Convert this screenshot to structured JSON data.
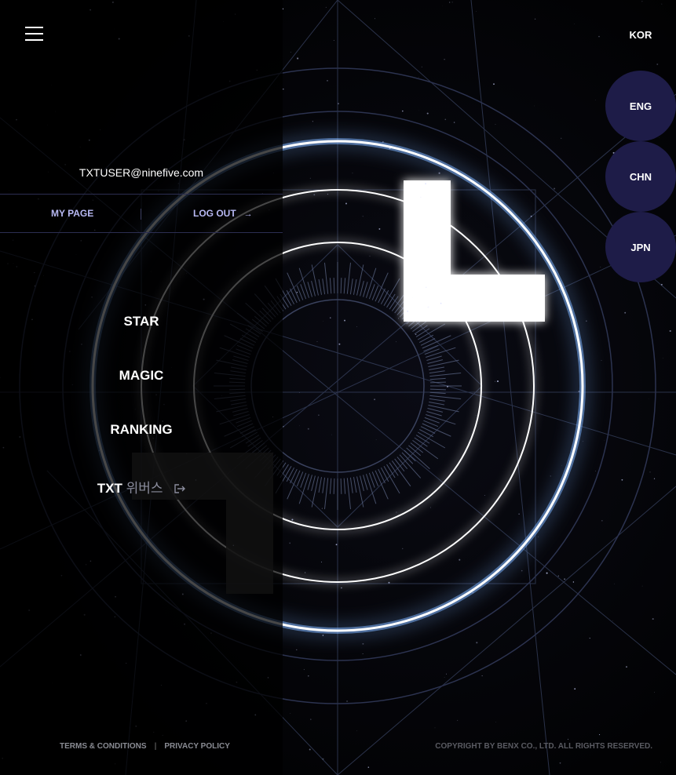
{
  "header": {
    "menu_icon": "hamburger-icon",
    "current_language": "KOR"
  },
  "languages": [
    "ENG",
    "CHN",
    "JPN"
  ],
  "user": {
    "email": "TXTUSER@ninefive.com"
  },
  "account": {
    "mypage_label": "MY PAGE",
    "logout_label": "LOG OUT",
    "logout_icon": "arrow-right-icon"
  },
  "nav": {
    "star": "STAR",
    "magic": "MAGIC",
    "ranking": "RANKING",
    "weverse_prefix": "TXT",
    "weverse_ko": "위버스",
    "weverse_icon": "external-link-icon"
  },
  "footer": {
    "terms": "TERMS & CONDITIONS",
    "separator": "|",
    "privacy": "PRIVACY POLICY",
    "copyright": "COPYRIGHT BY BENX CO., LTD. ALL RIGHTS RESERVED."
  },
  "colors": {
    "accent_link": "#b7b8f2",
    "lang_circle": "#1e1c48",
    "ring_glow": "#7fb4ff"
  }
}
